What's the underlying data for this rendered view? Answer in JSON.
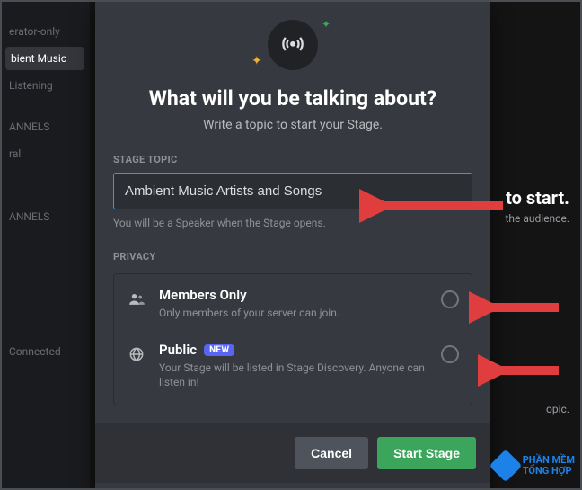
{
  "background": {
    "sidebar": {
      "items": [
        "",
        "erator-only",
        "bient Music",
        "Listening",
        "",
        "ANNELS",
        "ral",
        "",
        "",
        "ANNELS",
        "",
        "",
        "Connected"
      ]
    },
    "right": {
      "start_line": "to start.",
      "aud_line": "the audience.",
      "opic": "opic."
    }
  },
  "modal": {
    "title": "What will you be talking about?",
    "subtitle": "Write a topic to start your Stage.",
    "topic_label": "STAGE TOPIC",
    "topic_value": "Ambient Music Artists and Songs",
    "topic_helper": "You will be a Speaker when the Stage opens.",
    "privacy_label": "PRIVACY",
    "options": [
      {
        "title": "Members Only",
        "desc": "Only members of your server can join.",
        "badge": ""
      },
      {
        "title": "Public",
        "desc": "Your Stage will be listed in Stage Discovery. Anyone can listen in!",
        "badge": "NEW"
      }
    ],
    "cancel": "Cancel",
    "start": "Start Stage"
  },
  "watermark": {
    "line1": "PHẦN MỀM",
    "line2": "TỔNG HỢP"
  }
}
